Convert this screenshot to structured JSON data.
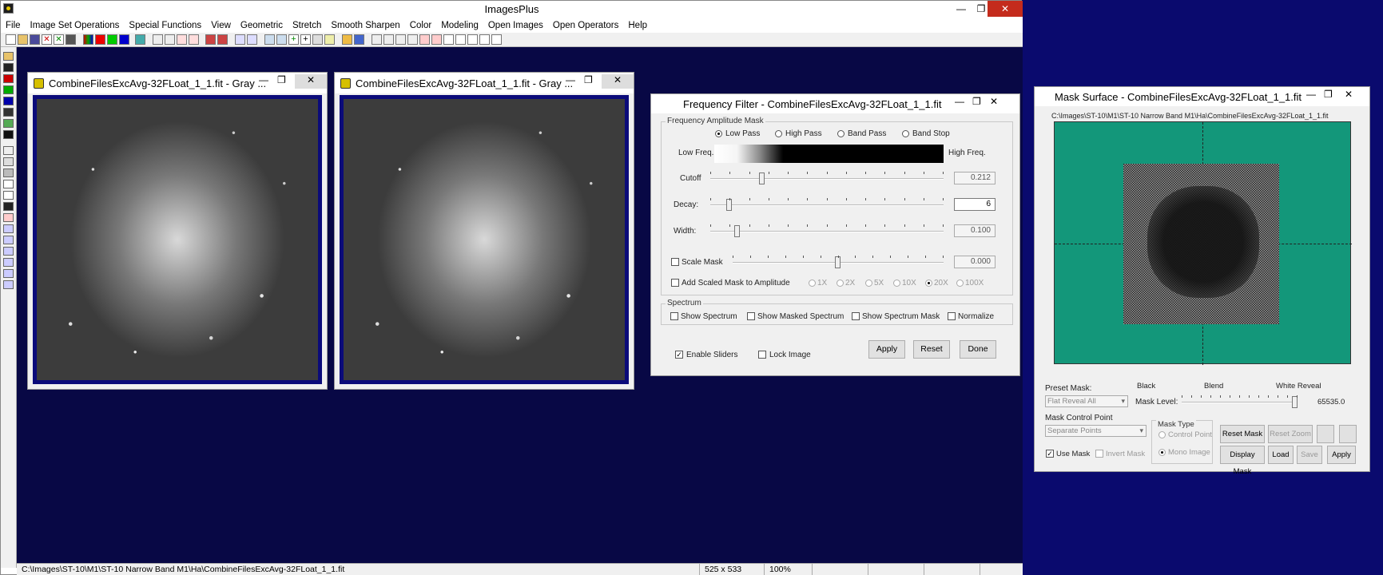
{
  "app": {
    "title": "ImagesPlus",
    "min": "—",
    "max": "❐",
    "close": "✕"
  },
  "menu": [
    "File",
    "Image Set Operations",
    "Special Functions",
    "View",
    "Geometric",
    "Stretch",
    "Smooth Sharpen",
    "Color",
    "Modeling",
    "Open Images",
    "Open Operators",
    "Help"
  ],
  "status": {
    "path": "C:\\Images\\ST-10\\M1\\ST-10 Narrow Band M1\\Ha\\CombineFilesExcAvg-32FLoat_1_1.fit",
    "size": "525 x 533",
    "zoom": "100%"
  },
  "image_windows": [
    {
      "title": "CombineFilesExcAvg-32FLoat_1_1.fit - Gray ..."
    },
    {
      "title": "CombineFilesExcAvg-32FLoat_1_1.fit - Gray ..."
    }
  ],
  "freq": {
    "title": "Frequency Filter - CombineFilesExcAvg-32FLoat_1_1.fit",
    "group_mask": "Frequency Amplitude Mask",
    "filters": [
      "Low Pass",
      "High Pass",
      "Band Pass",
      "Band Stop"
    ],
    "selected_filter": "Low Pass",
    "low_freq": "Low Freq.",
    "high_freq": "High Freq.",
    "cutoff_label": "Cutoff",
    "cutoff_value": "0.212",
    "decay_label": "Decay:",
    "decay_value": "6",
    "width_label": "Width:",
    "width_value": "0.100",
    "scale_mask_label": "Scale Mask",
    "scale_mask_value": "0.000",
    "add_scaled_label": "Add Scaled Mask to Amplitude",
    "multipliers": [
      "1X",
      "2X",
      "5X",
      "10X",
      "20X",
      "100X"
    ],
    "selected_multiplier": "20X",
    "group_spectrum": "Spectrum",
    "spectrum_opts": [
      "Show Spectrum",
      "Show Masked Spectrum",
      "Show Spectrum Mask",
      "Normalize"
    ],
    "enable_sliders": "Enable Sliders",
    "lock_image": "Lock Image",
    "apply": "Apply",
    "reset": "Reset",
    "done": "Done"
  },
  "mask": {
    "title": "Mask Surface - CombineFilesExcAvg-32FLoat_1_1.fit",
    "path": "C:\\Images\\ST-10\\M1\\ST-10 Narrow Band M1\\Ha\\CombineFilesExcAvg-32FLoat_1_1.fit",
    "surface_color": "#13977a",
    "preset_label": "Preset Mask:",
    "preset_value": "Flat Reveal All",
    "black": "Black",
    "blend": "Blend",
    "white_reveal": "White Reveal",
    "mask_level_label": "Mask Level:",
    "mask_level_value": "65535.0",
    "control_point_label": "Mask Control Point",
    "control_point_value": "Separate Points",
    "mask_type_label": "Mask Type",
    "control_point_radio": "Control Point",
    "mono_image_radio": "Mono Image",
    "use_mask": "Use Mask",
    "invert_mask": "Invert Mask",
    "reset_mask": "Reset Mask",
    "reset_zoom": "Reset Zoom",
    "display_mask": "Display Mask",
    "load": "Load",
    "save": "Save",
    "apply": "Apply"
  }
}
